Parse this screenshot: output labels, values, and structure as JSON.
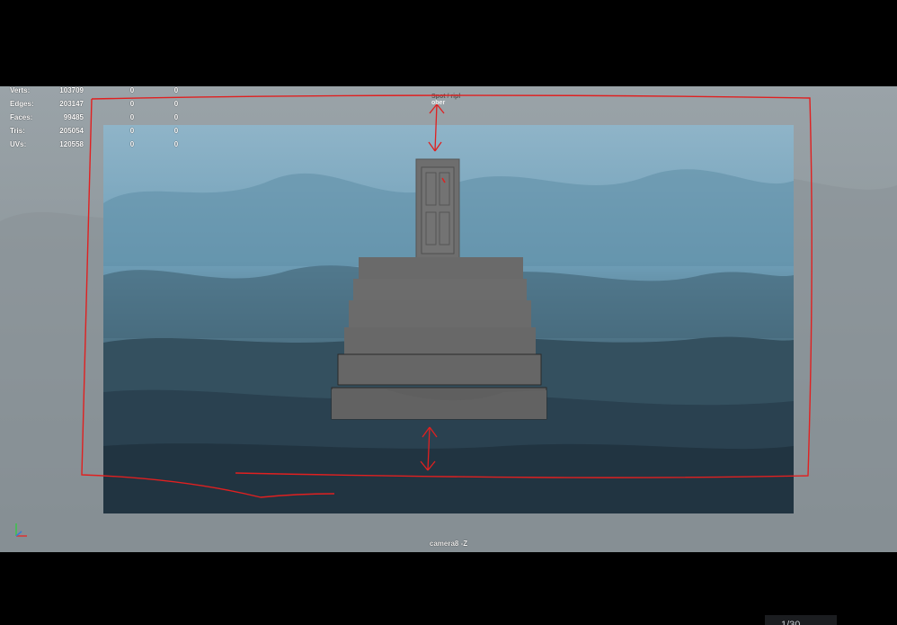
{
  "poly_count": {
    "rows": [
      {
        "label": "Verts:",
        "total": "103709",
        "selected": "0",
        "third": "0"
      },
      {
        "label": "Edges:",
        "total": "203147",
        "selected": "0",
        "third": "0"
      },
      {
        "label": "Faces:",
        "total": "99485",
        "selected": "0",
        "third": "0"
      },
      {
        "label": "Tris:",
        "total": "205054",
        "selected": "0",
        "third": "0"
      },
      {
        "label": "UVs:",
        "total": "120558",
        "selected": "0",
        "third": "0"
      }
    ]
  },
  "viewport": {
    "camera_label": "camera8 -Z",
    "top_overlay_line1": "Spot / ripl",
    "top_overlay_line2": "ober"
  },
  "corner_readout": "1/30",
  "colors": {
    "annotation": "#e02020",
    "sky_top": "#7aa6bd",
    "ground": "#2e4350",
    "building": "#6d6d6d"
  }
}
